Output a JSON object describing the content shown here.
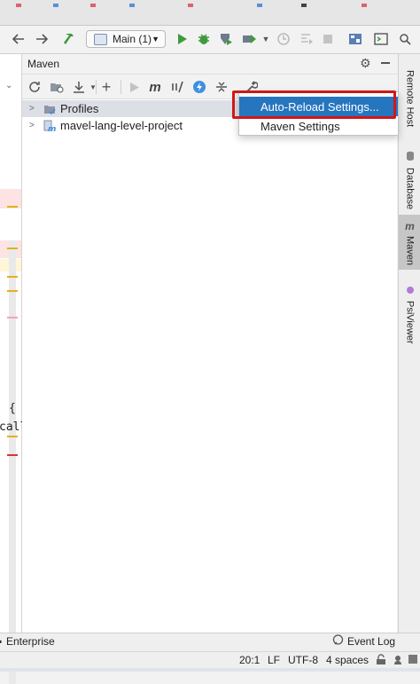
{
  "toolbar": {
    "back_icon": "arrow-left-icon",
    "forward_icon": "arrow-right-icon",
    "build_icon": "hammer-icon",
    "run_config": "Main (1)",
    "run_icon": "play-icon",
    "debug_icon": "bug-icon",
    "coverage_icon": "coverage-icon",
    "profile_icon": "profile-icon",
    "stop_icon": "stop-icon"
  },
  "editor_fragments": {
    "brace": "{",
    "call": "call"
  },
  "maven": {
    "title": "Maven",
    "gear_icon": "gear-icon",
    "minimize_icon": "minimize-icon",
    "tree": [
      {
        "label": "Profiles",
        "icon": "profiles-folder-icon"
      },
      {
        "label": "mavel-lang-level-project",
        "icon": "maven-module-icon"
      }
    ]
  },
  "popup": {
    "items": [
      "Auto-Reload Settings...",
      "Maven Settings"
    ],
    "highlighted": "Auto-Reload Settings..."
  },
  "right_tabs": [
    "Remote Host",
    "Database",
    "Maven",
    "PsiViewer"
  ],
  "statusbar": {
    "enterprise": "Enterprise",
    "event_log": "Event Log",
    "position": "20:1",
    "line_sep": "LF",
    "encoding": "UTF-8",
    "indent": "4 spaces"
  },
  "colors": {
    "accent": "#2675bf",
    "highlight_box": "#d01818",
    "run_green": "#3d9a3d"
  }
}
